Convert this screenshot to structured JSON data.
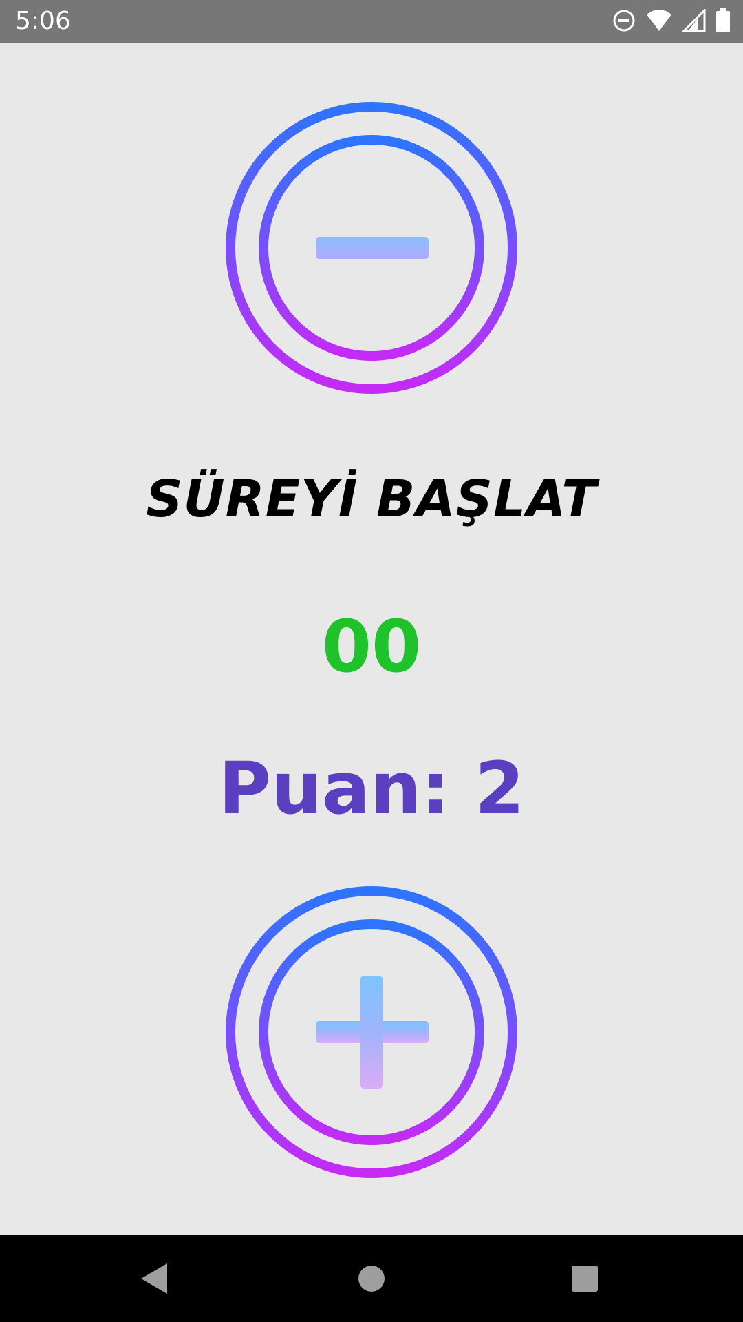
{
  "status_bar": {
    "time": "5:06",
    "icons": [
      "do-not-disturb-icon",
      "wifi-icon",
      "cell-signal-icon",
      "battery-icon"
    ]
  },
  "decrement_button": {
    "icon": "minus-circle-icon"
  },
  "increment_button": {
    "icon": "plus-circle-icon"
  },
  "timer": {
    "label": "SÜREYİ BAŞLAT"
  },
  "countdown": {
    "value": "00"
  },
  "score": {
    "text": "Puan: 2"
  },
  "nav_bar": {
    "buttons": [
      "back-icon",
      "home-icon",
      "recents-icon"
    ]
  },
  "colors": {
    "background": "#e8e8e9",
    "status_bar": "#777777",
    "countdown": "#1fc22b",
    "score": "#5a3fc0",
    "ring_top": "#2d74ff",
    "ring_bottom": "#c42bf5",
    "symbol_top": "#7cc4ff",
    "symbol_mid": "#a0b4fb",
    "symbol_bottom": "#dcaaf7"
  }
}
